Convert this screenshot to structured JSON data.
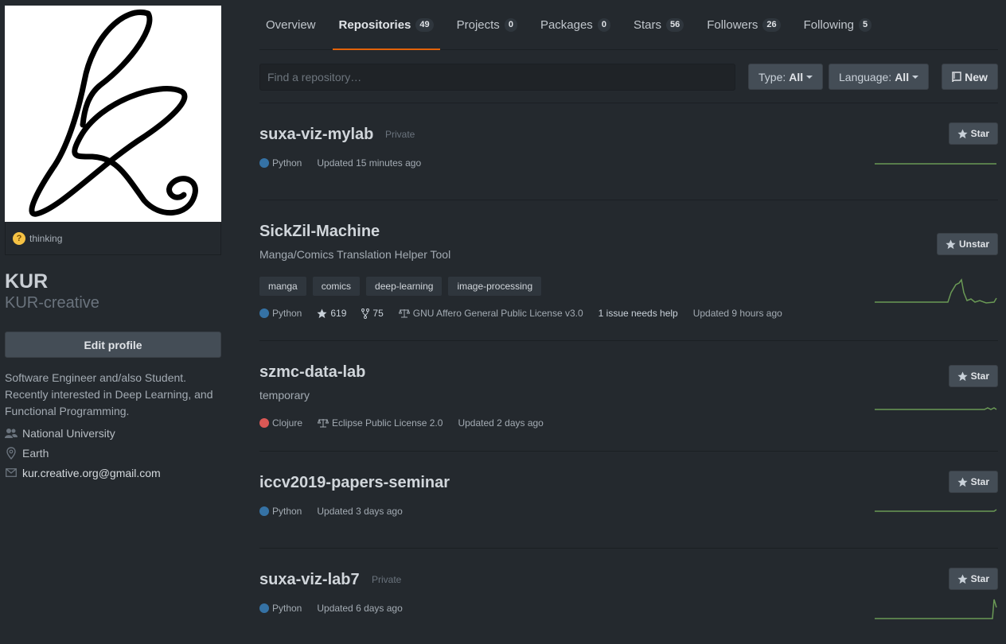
{
  "profile": {
    "status_emoji": "thinking-face-icon",
    "status_text": "thinking",
    "name": "KUR",
    "login": "KUR-creative",
    "edit_label": "Edit profile",
    "bio": "Software Engineer and/also Student. Recently interested in Deep Learning, and Functional Programming.",
    "organization": "National University",
    "location": "Earth",
    "email": "kur.creative.org@gmail.com"
  },
  "tabs": [
    {
      "label": "Overview",
      "count": null
    },
    {
      "label": "Repositories",
      "count": "49",
      "active": true
    },
    {
      "label": "Projects",
      "count": "0"
    },
    {
      "label": "Packages",
      "count": "0"
    },
    {
      "label": "Stars",
      "count": "56"
    },
    {
      "label": "Followers",
      "count": "26"
    },
    {
      "label": "Following",
      "count": "5"
    }
  ],
  "filter": {
    "search_placeholder": "Find a repository…",
    "type_label": "Type:",
    "type_value": "All",
    "language_label": "Language:",
    "language_value": "All",
    "new_label": "New"
  },
  "colors": {
    "accent_tab": "#e36209",
    "python": "#3572A5",
    "clojure": "#db5855",
    "sparkline": "#6a9955"
  },
  "repos": [
    {
      "name": "suxa-viz-mylab",
      "private_label": "Private",
      "language": "Python",
      "lang_color": "#3572A5",
      "updated": "Updated 15 minutes ago",
      "star_label": "Star"
    },
    {
      "name": "SickZil-Machine",
      "description": "Manga/Comics Translation Helper Tool",
      "topics": [
        "manga",
        "comics",
        "deep-learning",
        "image-processing"
      ],
      "language": "Python",
      "lang_color": "#3572A5",
      "stars": "619",
      "forks": "75",
      "license": "GNU Affero General Public License v3.0",
      "issues": "1 issue needs help",
      "updated": "Updated 9 hours ago",
      "star_label": "Unstar"
    },
    {
      "name": "szmc-data-lab",
      "description": "temporary",
      "language": "Clojure",
      "lang_color": "#db5855",
      "license": "Eclipse Public License 2.0",
      "updated": "Updated 2 days ago",
      "star_label": "Star"
    },
    {
      "name": "iccv2019-papers-seminar",
      "language": "Python",
      "lang_color": "#3572A5",
      "updated": "Updated 3 days ago",
      "star_label": "Star"
    },
    {
      "name": "suxa-viz-lab7",
      "private_label": "Private",
      "language": "Python",
      "lang_color": "#3572A5",
      "updated": "Updated 6 days ago",
      "star_label": "Star"
    }
  ]
}
